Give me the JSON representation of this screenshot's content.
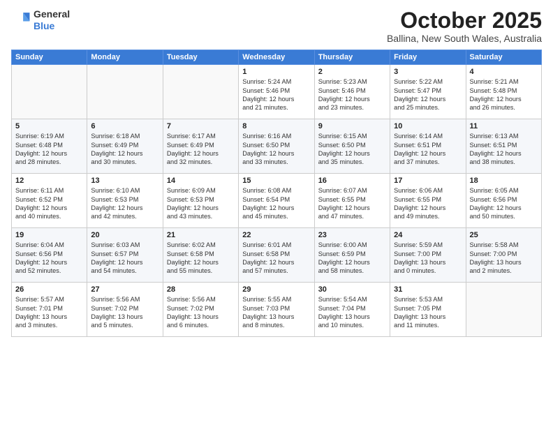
{
  "logo": {
    "general": "General",
    "blue": "Blue"
  },
  "header": {
    "month": "October 2025",
    "location": "Ballina, New South Wales, Australia"
  },
  "weekdays": [
    "Sunday",
    "Monday",
    "Tuesday",
    "Wednesday",
    "Thursday",
    "Friday",
    "Saturday"
  ],
  "weeks": [
    [
      {
        "day": "",
        "info": ""
      },
      {
        "day": "",
        "info": ""
      },
      {
        "day": "",
        "info": ""
      },
      {
        "day": "1",
        "info": "Sunrise: 5:24 AM\nSunset: 5:46 PM\nDaylight: 12 hours\nand 21 minutes."
      },
      {
        "day": "2",
        "info": "Sunrise: 5:23 AM\nSunset: 5:46 PM\nDaylight: 12 hours\nand 23 minutes."
      },
      {
        "day": "3",
        "info": "Sunrise: 5:22 AM\nSunset: 5:47 PM\nDaylight: 12 hours\nand 25 minutes."
      },
      {
        "day": "4",
        "info": "Sunrise: 5:21 AM\nSunset: 5:48 PM\nDaylight: 12 hours\nand 26 minutes."
      }
    ],
    [
      {
        "day": "5",
        "info": "Sunrise: 6:19 AM\nSunset: 6:48 PM\nDaylight: 12 hours\nand 28 minutes."
      },
      {
        "day": "6",
        "info": "Sunrise: 6:18 AM\nSunset: 6:49 PM\nDaylight: 12 hours\nand 30 minutes."
      },
      {
        "day": "7",
        "info": "Sunrise: 6:17 AM\nSunset: 6:49 PM\nDaylight: 12 hours\nand 32 minutes."
      },
      {
        "day": "8",
        "info": "Sunrise: 6:16 AM\nSunset: 6:50 PM\nDaylight: 12 hours\nand 33 minutes."
      },
      {
        "day": "9",
        "info": "Sunrise: 6:15 AM\nSunset: 6:50 PM\nDaylight: 12 hours\nand 35 minutes."
      },
      {
        "day": "10",
        "info": "Sunrise: 6:14 AM\nSunset: 6:51 PM\nDaylight: 12 hours\nand 37 minutes."
      },
      {
        "day": "11",
        "info": "Sunrise: 6:13 AM\nSunset: 6:51 PM\nDaylight: 12 hours\nand 38 minutes."
      }
    ],
    [
      {
        "day": "12",
        "info": "Sunrise: 6:11 AM\nSunset: 6:52 PM\nDaylight: 12 hours\nand 40 minutes."
      },
      {
        "day": "13",
        "info": "Sunrise: 6:10 AM\nSunset: 6:53 PM\nDaylight: 12 hours\nand 42 minutes."
      },
      {
        "day": "14",
        "info": "Sunrise: 6:09 AM\nSunset: 6:53 PM\nDaylight: 12 hours\nand 43 minutes."
      },
      {
        "day": "15",
        "info": "Sunrise: 6:08 AM\nSunset: 6:54 PM\nDaylight: 12 hours\nand 45 minutes."
      },
      {
        "day": "16",
        "info": "Sunrise: 6:07 AM\nSunset: 6:55 PM\nDaylight: 12 hours\nand 47 minutes."
      },
      {
        "day": "17",
        "info": "Sunrise: 6:06 AM\nSunset: 6:55 PM\nDaylight: 12 hours\nand 49 minutes."
      },
      {
        "day": "18",
        "info": "Sunrise: 6:05 AM\nSunset: 6:56 PM\nDaylight: 12 hours\nand 50 minutes."
      }
    ],
    [
      {
        "day": "19",
        "info": "Sunrise: 6:04 AM\nSunset: 6:56 PM\nDaylight: 12 hours\nand 52 minutes."
      },
      {
        "day": "20",
        "info": "Sunrise: 6:03 AM\nSunset: 6:57 PM\nDaylight: 12 hours\nand 54 minutes."
      },
      {
        "day": "21",
        "info": "Sunrise: 6:02 AM\nSunset: 6:58 PM\nDaylight: 12 hours\nand 55 minutes."
      },
      {
        "day": "22",
        "info": "Sunrise: 6:01 AM\nSunset: 6:58 PM\nDaylight: 12 hours\nand 57 minutes."
      },
      {
        "day": "23",
        "info": "Sunrise: 6:00 AM\nSunset: 6:59 PM\nDaylight: 12 hours\nand 58 minutes."
      },
      {
        "day": "24",
        "info": "Sunrise: 5:59 AM\nSunset: 7:00 PM\nDaylight: 13 hours\nand 0 minutes."
      },
      {
        "day": "25",
        "info": "Sunrise: 5:58 AM\nSunset: 7:00 PM\nDaylight: 13 hours\nand 2 minutes."
      }
    ],
    [
      {
        "day": "26",
        "info": "Sunrise: 5:57 AM\nSunset: 7:01 PM\nDaylight: 13 hours\nand 3 minutes."
      },
      {
        "day": "27",
        "info": "Sunrise: 5:56 AM\nSunset: 7:02 PM\nDaylight: 13 hours\nand 5 minutes."
      },
      {
        "day": "28",
        "info": "Sunrise: 5:56 AM\nSunset: 7:02 PM\nDaylight: 13 hours\nand 6 minutes."
      },
      {
        "day": "29",
        "info": "Sunrise: 5:55 AM\nSunset: 7:03 PM\nDaylight: 13 hours\nand 8 minutes."
      },
      {
        "day": "30",
        "info": "Sunrise: 5:54 AM\nSunset: 7:04 PM\nDaylight: 13 hours\nand 10 minutes."
      },
      {
        "day": "31",
        "info": "Sunrise: 5:53 AM\nSunset: 7:05 PM\nDaylight: 13 hours\nand 11 minutes."
      },
      {
        "day": "",
        "info": ""
      }
    ]
  ]
}
